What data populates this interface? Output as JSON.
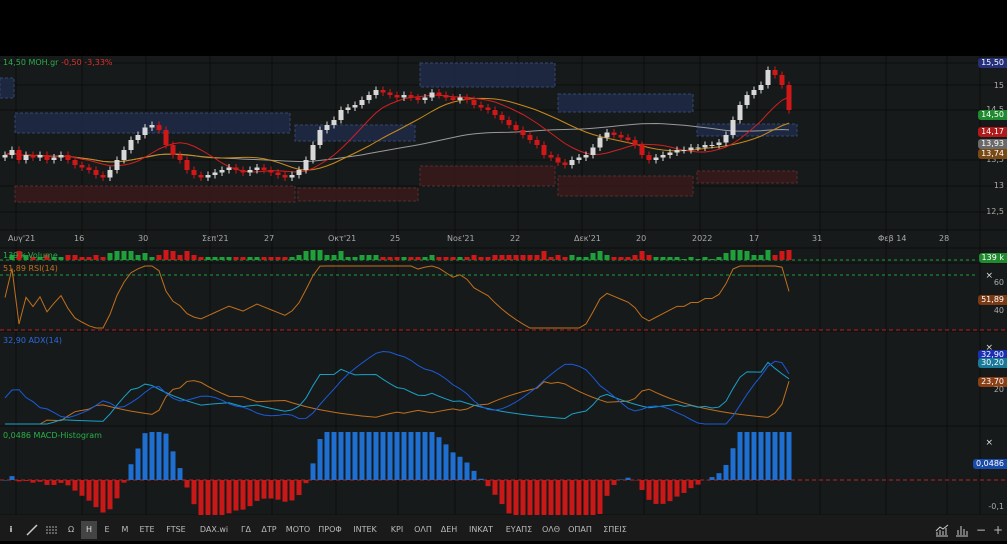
{
  "header": {
    "last": "14,50",
    "symbol": "MOH.gr",
    "change": "-0,50",
    "change_pct": "-3,33%"
  },
  "price_axis": {
    "ticks": [
      "15,50",
      "15",
      "14,5",
      "13,5",
      "13",
      "12,5"
    ],
    "tags": [
      {
        "text": "15,50",
        "color": "#26307a"
      },
      {
        "text": "14,50",
        "color": "#1f8a2e"
      },
      {
        "text": "14,17",
        "color": "#b01a1a"
      },
      {
        "text": "13,93",
        "color": "#6a6a6a"
      },
      {
        "text": "13,74",
        "color": "#7a4a14"
      }
    ]
  },
  "x_axis": [
    "Αυγ'21",
    "16",
    "30",
    "Σεπ'21",
    "27",
    "Οκτ'21",
    "25",
    "Νοε'21",
    "22",
    "Δεκ'21",
    "20",
    "2022",
    "17",
    "31",
    "Φεβ 14",
    "28"
  ],
  "volume": {
    "label": "139 k Volume",
    "tag": "139 k"
  },
  "rsi": {
    "label": "51,89 RSI(14)",
    "tag": "51,89",
    "ticks": [
      "60",
      "40"
    ]
  },
  "adx": {
    "label": "32,90 ADX(14)",
    "tags": [
      "32,90",
      "30,20",
      "23,70"
    ],
    "ticks": [
      "20"
    ]
  },
  "macd": {
    "label": "0,0486 MACD-Histogram",
    "tag": "0,0486",
    "ticks": [
      "-0,1"
    ]
  },
  "toolbar": {
    "items": [
      "Ω",
      "Η",
      "Ε",
      "Μ",
      "ETE",
      "FTSE",
      "DAX.wi",
      "ΓΔ",
      "ΔΤΡ",
      "ΜΟΤΟ",
      "ΠΡΟΦ",
      "ΙΝΤΕΚ",
      "ΚΡΙ",
      "ΟΛΠ",
      "ΔΕΗ",
      "ΙΝΚΑΤ",
      "ΕΥΑΠΣ",
      "ΟΛΘ",
      "ΟΠΑΠ",
      "ΣΠΕΙΣ"
    ],
    "active": "Η"
  },
  "colors": {
    "up": "#d8d8d8",
    "down": "#d01818",
    "ma_short": "#d02020",
    "ma_mid": "#c88a1a",
    "ma_long": "#9a9a9a",
    "vol_up": "#1fa03a",
    "vol_down": "#d01818",
    "rsi": "#c0701c",
    "adx": "#1a5bd8",
    "di_plus": "#1aa0c8",
    "di_minus": "#c0701c",
    "macd_pos": "#1e6fd0",
    "macd_neg": "#c81818"
  },
  "chart_data": {
    "type": "candlestick",
    "symbol": "MOH.gr",
    "ylim": [
      12.3,
      15.7
    ],
    "closes": [
      13.6,
      13.7,
      13.5,
      13.6,
      13.55,
      13.6,
      13.5,
      13.55,
      13.6,
      13.5,
      13.4,
      13.35,
      13.3,
      13.2,
      13.15,
      13.3,
      13.5,
      13.7,
      13.9,
      14.0,
      14.15,
      14.2,
      14.1,
      13.8,
      13.6,
      13.5,
      13.3,
      13.2,
      13.15,
      13.2,
      13.25,
      13.3,
      13.35,
      13.3,
      13.25,
      13.3,
      13.35,
      13.3,
      13.25,
      13.2,
      13.15,
      13.2,
      13.3,
      13.5,
      13.8,
      14.1,
      14.2,
      14.3,
      14.5,
      14.55,
      14.6,
      14.7,
      14.8,
      14.9,
      14.85,
      14.8,
      14.75,
      14.8,
      14.75,
      14.7,
      14.75,
      14.85,
      14.8,
      14.75,
      14.7,
      14.75,
      14.7,
      14.6,
      14.55,
      14.5,
      14.4,
      14.3,
      14.2,
      14.1,
      14.0,
      13.9,
      13.8,
      13.6,
      13.55,
      13.45,
      13.4,
      13.5,
      13.55,
      13.6,
      13.75,
      13.95,
      14.05,
      14.0,
      13.95,
      13.9,
      13.8,
      13.6,
      13.5,
      13.55,
      13.6,
      13.65,
      13.7,
      13.7,
      13.75,
      13.75,
      13.8,
      13.8,
      13.85,
      14.0,
      14.3,
      14.6,
      14.8,
      14.9,
      15.0,
      15.3,
      15.2,
      15.0,
      14.5
    ]
  }
}
